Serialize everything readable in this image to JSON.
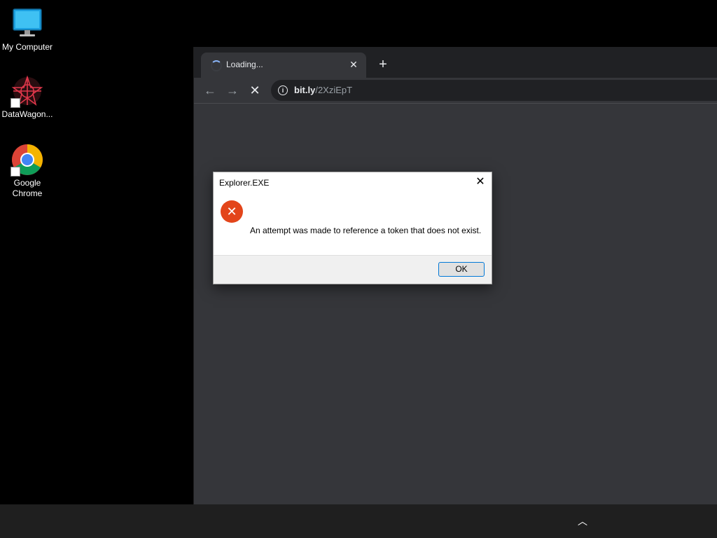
{
  "desktop": {
    "icons": [
      {
        "label": "My Computer",
        "icon": "monitor-icon"
      },
      {
        "label": "DataWagon...",
        "icon": "datawagon-app-icon"
      },
      {
        "label": "Google Chrome",
        "icon": "chrome-icon"
      }
    ]
  },
  "browser": {
    "tab": {
      "title": "Loading...",
      "close": "✕"
    },
    "new_tab": "+",
    "nav": {
      "back": "←",
      "forward": "→",
      "stop": "✕"
    },
    "omnibox": {
      "host": "bit.ly",
      "path": "/2XziEpT",
      "info": "i"
    }
  },
  "dialog": {
    "title": "Explorer.EXE",
    "close": "✕",
    "icon_glyph": "✕",
    "message": "An attempt was made to reference a token that does not exist.",
    "ok_label": "OK"
  },
  "taskbar": {
    "tray_chevron": "︿"
  },
  "colors": {
    "error_icon": "#e3451a",
    "browser_bg": "#35363a",
    "tabstrip_bg": "#202124",
    "taskbar_bg": "#1f1f1f"
  }
}
